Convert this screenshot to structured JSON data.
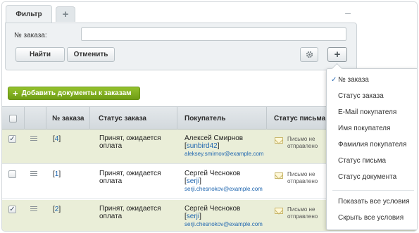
{
  "filter": {
    "tab_label": "Фильтр",
    "tab_add": "+",
    "collapse": "–",
    "order_label": "№ заказа:",
    "order_value": "",
    "find_label": "Найти",
    "cancel_label": "Отменить",
    "gear_icon": "gear-icon",
    "add_condition": "+"
  },
  "toolbar": {
    "add_docs_label": "Добавить документы к заказам",
    "add_docs_plus": "+"
  },
  "grid": {
    "headers": [
      "№ заказа",
      "Статус заказа",
      "Покупатель",
      "Статус письма"
    ],
    "rows": [
      {
        "checked": true,
        "check": "✓",
        "order": "4",
        "status": "Принят, ожидается оплата",
        "buyer_name": "Алексей Смирнов",
        "buyer_login": "sunbird42",
        "buyer_email": "aleksey.smirnov@example.com",
        "letter_status": "Письмо не отправлено"
      },
      {
        "checked": false,
        "check": "",
        "order": "1",
        "status": "Принят, ожидается оплата",
        "buyer_name": "Сергей Чесноков",
        "buyer_login": "serji",
        "buyer_email": "serji.chesnokov@example.com",
        "letter_status": "Письмо не отправлено"
      },
      {
        "checked": true,
        "check": "✓",
        "order": "2",
        "status": "Принят, ожидается оплата",
        "buyer_name": "Сергей Чесноков",
        "buyer_login": "serji",
        "buyer_email": "serji.chesnokov@example.com",
        "letter_status": "Письмо не отправлено"
      }
    ]
  },
  "dropdown": {
    "items": [
      {
        "label": "№ заказа",
        "checked": true
      },
      {
        "label": "Статус заказа",
        "checked": false
      },
      {
        "label": "E-Mail покупателя",
        "checked": false
      },
      {
        "label": "Имя покупателя",
        "checked": false
      },
      {
        "label": "Фамилия покупателя",
        "checked": false
      },
      {
        "label": "Статус письма",
        "checked": false
      },
      {
        "label": "Статус документа",
        "checked": false
      }
    ],
    "check_mark": "✓",
    "show_all": "Показать все условия",
    "hide_all": "Скрыть все условия"
  },
  "colors": {
    "accent_green": "#7fad1e",
    "link_blue": "#2067b0",
    "selected_row": "#eaeed8"
  }
}
